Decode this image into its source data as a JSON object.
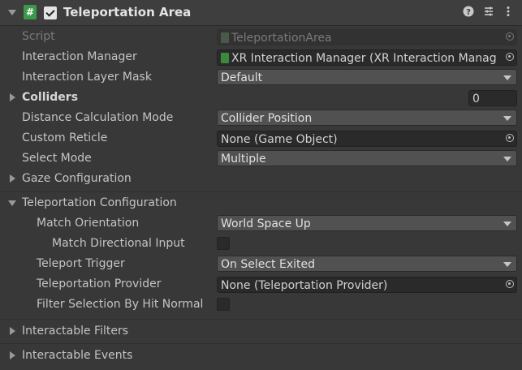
{
  "component": {
    "title": "Teleportation Area",
    "enabled": true,
    "header_icons": [
      "help-icon",
      "preset-icon",
      "context-menu-icon"
    ]
  },
  "fields": {
    "script": {
      "label": "Script",
      "value": "TeleportationArea"
    },
    "interaction_manager": {
      "label": "Interaction Manager",
      "value": "XR Interaction Manager (XR Interaction Manag"
    },
    "interaction_layer_mask": {
      "label": "Interaction Layer Mask",
      "value": "Default"
    },
    "colliders": {
      "label": "Colliders",
      "value": "0"
    },
    "distance_calc_mode": {
      "label": "Distance Calculation Mode",
      "value": "Collider Position"
    },
    "custom_reticle": {
      "label": "Custom Reticle",
      "value": "None (Game Object)"
    },
    "select_mode": {
      "label": "Select Mode",
      "value": "Multiple"
    },
    "gaze_configuration": {
      "label": "Gaze Configuration"
    },
    "teleportation_configuration": {
      "label": "Teleportation Configuration"
    },
    "match_orientation": {
      "label": "Match Orientation",
      "value": "World Space Up"
    },
    "match_directional_input": {
      "label": "Match Directional Input",
      "checked": false
    },
    "teleport_trigger": {
      "label": "Teleport Trigger",
      "value": "On Select Exited"
    },
    "teleportation_provider": {
      "label": "Teleportation Provider",
      "value": "None (Teleportation Provider)"
    },
    "filter_selection_by_hit_normal": {
      "label": "Filter Selection By Hit Normal",
      "checked": false
    },
    "interactable_filters": {
      "label": "Interactable Filters"
    },
    "interactable_events": {
      "label": "Interactable Events"
    }
  }
}
